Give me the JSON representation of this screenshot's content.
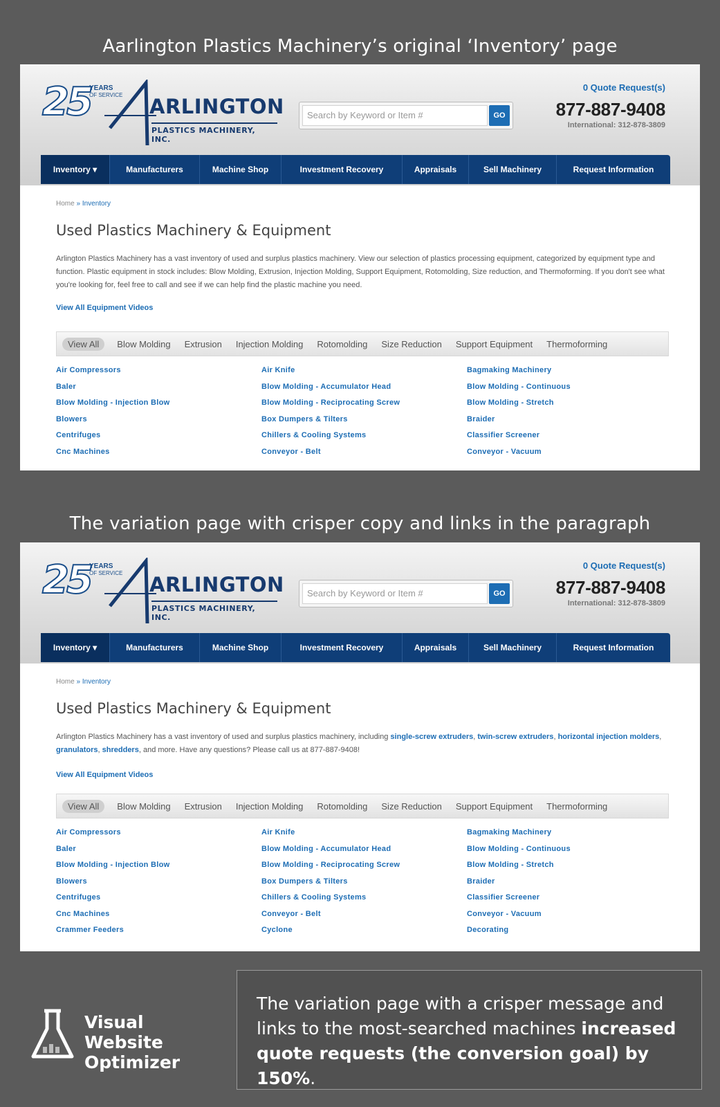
{
  "captions": {
    "top": "Aarlington Plastics Machinery’s original ‘Inventory’ page",
    "middle": "The variation page with crisper copy and links in the paragraph"
  },
  "site": {
    "logo": {
      "years_num": "25",
      "years": "YEARS",
      "of_service": "OF SERVICE",
      "brand": "ARLINGTON",
      "sub": "PLASTICS MACHINERY, INC."
    },
    "search_placeholder": "Search by Keyword or Item #",
    "search_button": "GO",
    "quote_requests": "0 Quote Request(s)",
    "phone": "877-887-9408",
    "international": "International: 312-878-3809",
    "nav": [
      "Inventory ▾",
      "Manufacturers",
      "Machine Shop",
      "Investment Recovery",
      "Appraisals",
      "Sell Machinery",
      "Request Information"
    ],
    "breadcrumb_home": "Home",
    "breadcrumb_sep": " » ",
    "breadcrumb_current": "Inventory",
    "page_title": "Used Plastics Machinery & Equipment",
    "videos_link": "View All Equipment Videos",
    "filters": [
      "View All",
      "Blow Molding",
      "Extrusion",
      "Injection Molding",
      "Rotomolding",
      "Size Reduction",
      "Support Equipment",
      "Thermoforming"
    ]
  },
  "original": {
    "paragraph": "Arlington Plastics Machinery has a vast inventory of used and surplus plastics machinery. View our selection of plastics processing equipment, categorized by equipment type and function. Plastic equipment in stock includes: Blow Molding, Extrusion, Injection Molding, Support Equipment, Rotomolding, Size reduction, and Thermoforming. If you don't see what you're looking for, feel free to call and see if we can help find the plastic machine you need.",
    "col1": [
      "Air Compressors",
      "Baler",
      "Blow Molding - Injection Blow",
      "Blowers",
      "Centrifuges",
      "Cnc Machines"
    ],
    "col2": [
      "Air Knife",
      "Blow Molding - Accumulator Head",
      "Blow Molding - Reciprocating Screw",
      "Box Dumpers & Tilters",
      "Chillers & Cooling Systems",
      "Conveyor - Belt"
    ],
    "col3": [
      "Bagmaking Machinery",
      "Blow Molding - Continuous",
      "Blow Molding - Stretch",
      "Braider",
      "Classifier Screener",
      "Conveyor - Vacuum"
    ]
  },
  "variation": {
    "p1": "Arlington Plastics Machinery has a vast inventory of used and surplus plastics machinery, including ",
    "l1": "single-screw extruders",
    "s1": ", ",
    "l2": "twin-screw extruders",
    "s2": ", ",
    "l3": "horizontal injection molders",
    "s3": ", ",
    "l4": "granulators",
    "s4": ", ",
    "l5": "shredders",
    "p2": ", and more. Have any questions? Please call us at 877-887-9408!",
    "col1": [
      "Air Compressors",
      "Baler",
      "Blow Molding - Injection Blow",
      "Blowers",
      "Centrifuges",
      "Cnc Machines",
      "Crammer Feeders"
    ],
    "col2": [
      "Air Knife",
      "Blow Molding - Accumulator Head",
      "Blow Molding - Reciprocating Screw",
      "Box Dumpers & Tilters",
      "Chillers & Cooling Systems",
      "Conveyor - Belt",
      "Cyclone"
    ],
    "col3": [
      "Bagmaking Machinery",
      "Blow Molding - Continuous",
      "Blow Molding - Stretch",
      "Braider",
      "Classifier Screener",
      "Conveyor - Vacuum",
      "Decorating"
    ]
  },
  "footer": {
    "brand_line1": "Visual Website",
    "brand_line2": "Optimizer",
    "text_start": "The variation page with a crisper message and links to the most-searched machines ",
    "text_bold": "increased quote requests (the conversion goal) by 150%",
    "text_end": "."
  }
}
